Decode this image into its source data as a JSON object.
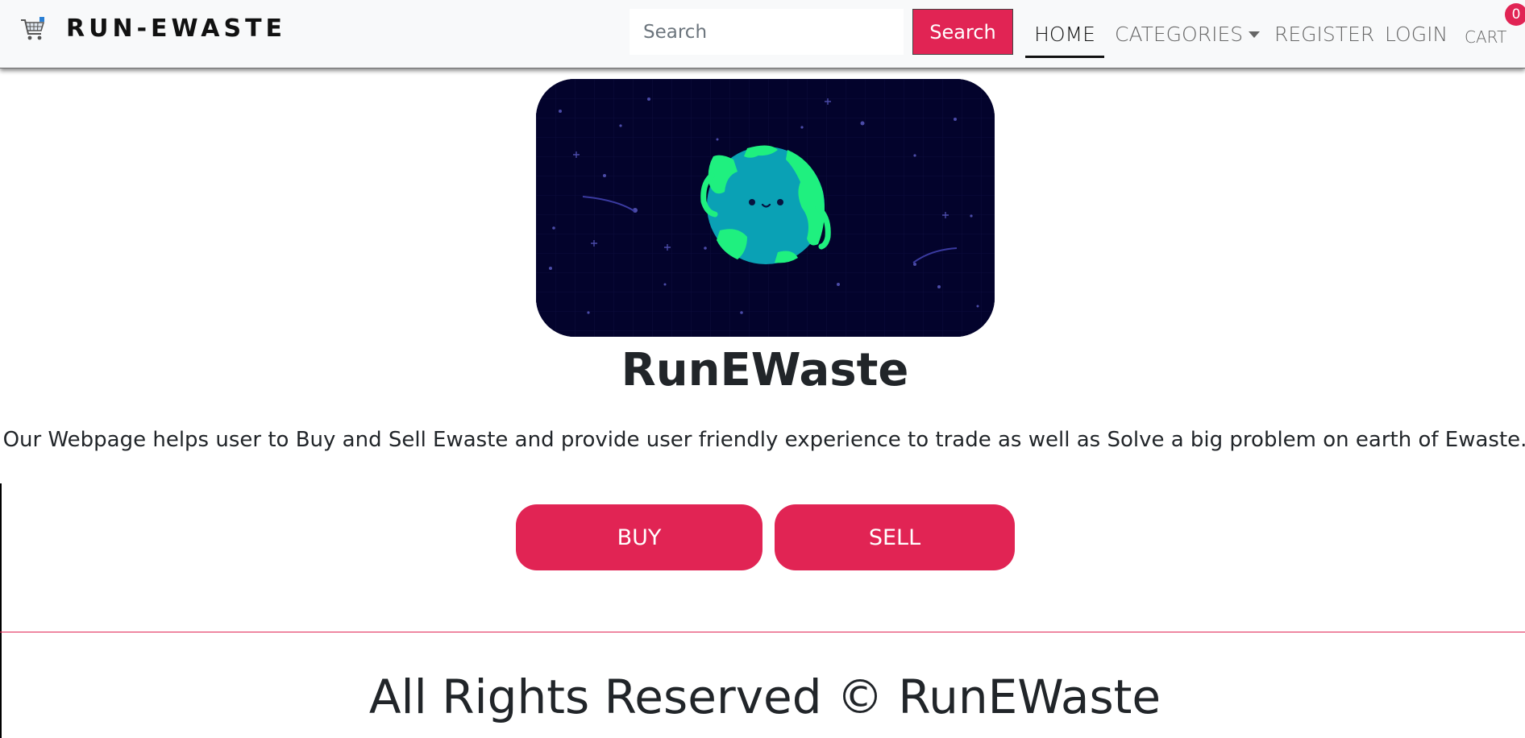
{
  "navbar": {
    "brand_icon": "shopping-cart-icon",
    "brand": "RUN-EWASTE",
    "search": {
      "placeholder": "Search",
      "value": "",
      "button_label": "Search"
    },
    "links": {
      "home": "HOME",
      "categories": "CATEGORIES",
      "register": "REGISTER",
      "login": "LOGIN",
      "cart": "CART"
    },
    "cart_count": "0",
    "active_link": "HOME"
  },
  "hero": {
    "image": "cartoon-earth-in-space-illustration",
    "title": "RunEWaste",
    "description": "Our Webpage helps user to Buy and Sell Ewaste and provide user friendly experience to trade as well as Solve a big problem on earth of Ewaste.",
    "buy_label": "BUY",
    "sell_label": "SELL"
  },
  "footer": {
    "text": "All Rights Reserved © RunEWaste"
  },
  "colors": {
    "accent": "#e12454",
    "navbar_bg": "#f8f9fa",
    "space_bg": "#03032c",
    "ocean": "#0aa1b5",
    "land": "#1ff07f"
  }
}
